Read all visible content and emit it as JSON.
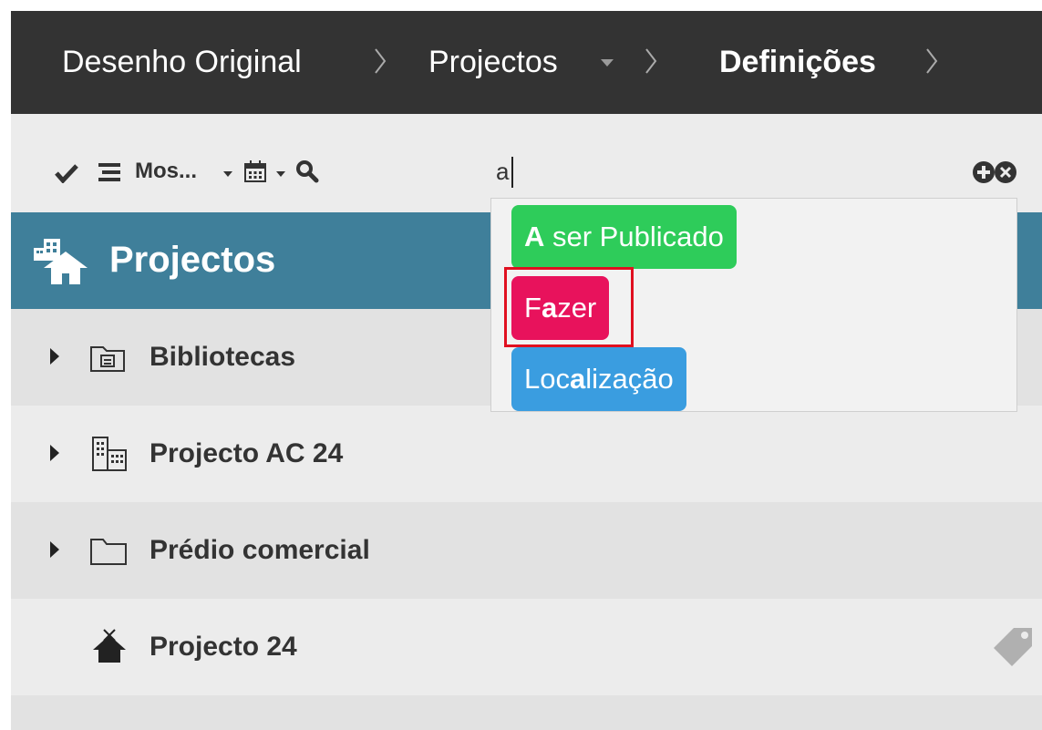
{
  "breadcrumb": {
    "items": [
      "Desenho Original",
      "Projectos",
      "Definições"
    ]
  },
  "toolbar": {
    "view_label": "Mos...",
    "search_value": "a"
  },
  "project_header": {
    "title": "Projectos"
  },
  "tree": {
    "rows": [
      {
        "label": "Bibliotecas"
      },
      {
        "label": "Projecto AC 24"
      },
      {
        "label": "Prédio comercial"
      },
      {
        "label": "Projecto 24"
      }
    ]
  },
  "suggestions": {
    "items": [
      {
        "pre": "",
        "match": "A",
        "post": " ser Publicado",
        "color": "#2ecc5a"
      },
      {
        "pre": "F",
        "match": "a",
        "post": "zer",
        "color": "#e8125c"
      },
      {
        "pre": "Loc",
        "match": "a",
        "post": "lização",
        "color": "#3a9de0"
      }
    ]
  },
  "colors": {
    "header_bar": "#333333",
    "project_header": "#3f7f9a",
    "highlight_outline": "#e01020"
  }
}
